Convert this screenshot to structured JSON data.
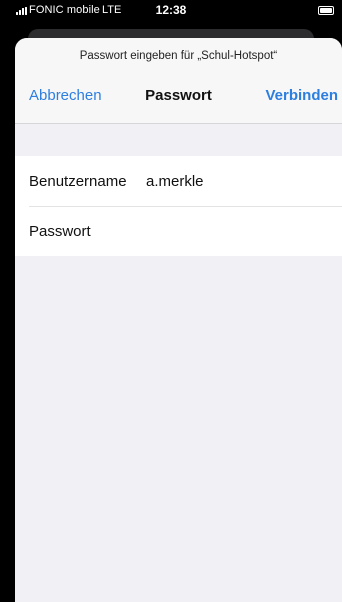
{
  "status_bar": {
    "carrier": "FONIC mobile",
    "network": "LTE",
    "time": "12:38"
  },
  "sheet": {
    "prompt": "Passwort eingeben für „Schul-Hotspot“",
    "title": "Passwort",
    "cancel_label": "Abbrechen",
    "connect_label": "Verbinden"
  },
  "form": {
    "username_label": "Benutzername",
    "username_value": "a.merkle",
    "password_label": "Passwort",
    "password_value": ""
  },
  "colors": {
    "accent": "#2c7ee0",
    "sheet_background": "#f0f0f5",
    "nav_background": "#f7f7f7"
  }
}
